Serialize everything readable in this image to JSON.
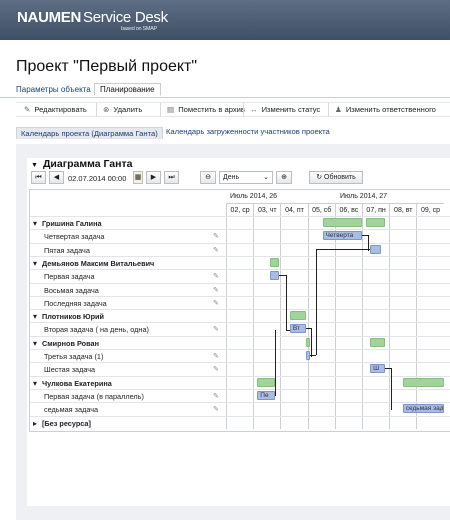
{
  "brand": {
    "name": "NAUMEN",
    "product": "Service Desk",
    "sub": "based on SMAP"
  },
  "page_title": "Проект \"Первый проект\"",
  "tabs": [
    "Параметры объекта",
    "Планирование"
  ],
  "toolbar": {
    "edit": "Редактировать",
    "delete": "Удалить",
    "archive": "Поместить в архив",
    "status": "Изменить статус",
    "responsible": "Изменить ответственного"
  },
  "subtabs": [
    "Календарь проекта (Диаграмма Ганта)",
    "Календарь загруженности участников проекта"
  ],
  "gantt": {
    "title": "Диаграмма Ганта",
    "date_value": "02.07.2014 00:00",
    "scale_value": "День",
    "refresh_label": "Обновить",
    "weeks": [
      "Июль 2014, 26",
      "Июль 2014, 27"
    ],
    "days": [
      "02, ср",
      "03, чт",
      "04, пт",
      "05, сб",
      "06, вс",
      "07, пн",
      "08, вт",
      "09, ср"
    ],
    "rows": [
      {
        "label": "Гришина Галина",
        "group": true
      },
      {
        "label": "Четвертая задача",
        "group": false
      },
      {
        "label": "Пятая задача",
        "group": false
      },
      {
        "label": "Демьянов Максим Витальевич",
        "group": true
      },
      {
        "label": "Первая задача",
        "group": false
      },
      {
        "label": "Восьмая задача",
        "group": false
      },
      {
        "label": "Последняя задача",
        "group": false
      },
      {
        "label": "Плотников Юрий",
        "group": true
      },
      {
        "label": "Вторая задача ( на день, одна)",
        "group": false
      },
      {
        "label": "Смирнов Рован",
        "group": true
      },
      {
        "label": "Третья задача (1)",
        "group": false
      },
      {
        "label": "Шестая задача",
        "group": false
      },
      {
        "label": "Чулкова Екатерина",
        "group": true
      },
      {
        "label": "Первая задача (в параллель)",
        "group": false
      },
      {
        "label": "седьмая задача",
        "group": false
      },
      {
        "label": "[Без ресурса]",
        "group": true
      }
    ],
    "bar_labels": {
      "chetvertaya": "Четверта",
      "vt": "Вт",
      "pe": "Пе",
      "sh": "Ш",
      "sedmaya": "седьмая задача"
    }
  },
  "colors": {
    "header": "#4b5b70",
    "group_bar": "#9fd49a",
    "task_bar": "#a9bde0"
  }
}
